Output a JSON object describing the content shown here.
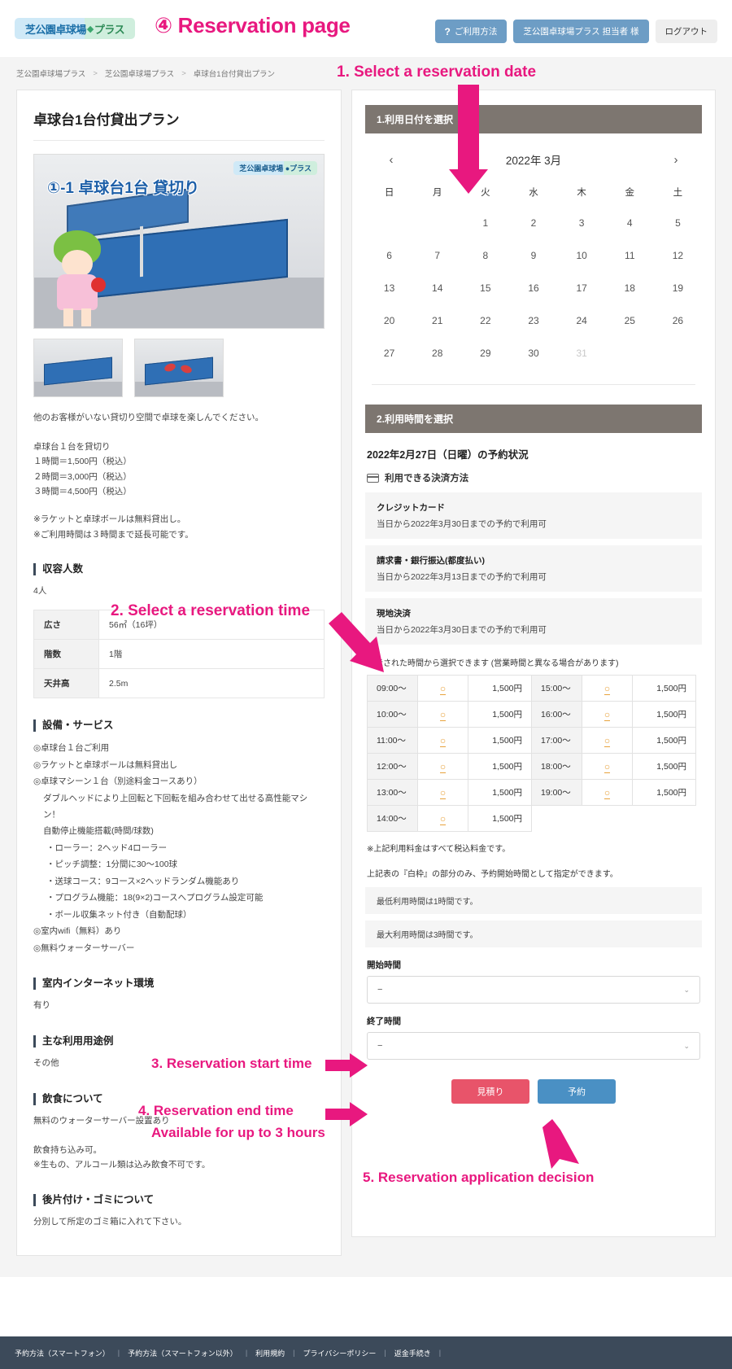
{
  "header": {
    "logo_text": "芝公園卓球場",
    "logo_text2": "プラス",
    "page_label": "④ Reservation page",
    "buttons": {
      "help_mark": "?",
      "help": "ご利用方法",
      "account": "芝公園卓球場プラス 担当者 様",
      "logout": "ログアウト"
    }
  },
  "breadcrumb": {
    "items": [
      "芝公園卓球場プラス",
      "芝公園卓球場プラス",
      "卓球台1台付貸出プラン"
    ],
    "separator": ">"
  },
  "left": {
    "plan_title": "卓球台1台付貸出プラン",
    "photo_caption": "①-1 卓球台1台 貸切り",
    "photo_badge": "芝公園卓球場 ●プラス",
    "lead": "他のお客様がいない貸切り空間で卓球を楽しんでください。",
    "price_lines": [
      "卓球台１台を貸切り",
      "１時間＝1,500円（税込）",
      "２時間＝3,000円（税込）",
      "３時間＝4,500円（税込）"
    ],
    "notes": [
      "※ラケットと卓球ボールは無料貸出し。",
      "※ご利用時間は３時間まで延長可能です。"
    ],
    "capacity_head": "収容人数",
    "capacity_value": "4人",
    "spec_rows": [
      {
        "label": "広さ",
        "value": "56㎡（16坪）"
      },
      {
        "label": "階数",
        "value": "1階"
      },
      {
        "label": "天井高",
        "value": "2.5m"
      }
    ],
    "facility_head": "設備・サービス",
    "facility_items": [
      {
        "text": "◎卓球台１台ご利用",
        "indent": 0
      },
      {
        "text": "◎ラケットと卓球ボールは無料貸出し",
        "indent": 0
      },
      {
        "text": "◎卓球マシーン１台（別途料金コースあり）",
        "indent": 0
      },
      {
        "text": "ダブルヘッドにより上回転と下回転を組み合わせて出せる高性能マシン！",
        "indent": 1
      },
      {
        "text": "自動停止機能搭載(時間/球数)",
        "indent": 1
      },
      {
        "text": "・ローラー：2ヘッド4ローラー",
        "indent": 2
      },
      {
        "text": "・ピッチ調整：1分間に30〜100球",
        "indent": 2
      },
      {
        "text": "・送球コース：9コース×2ヘッドランダム機能あり",
        "indent": 2
      },
      {
        "text": "・プログラム機能：18(9×2)コースへプログラム設定可能",
        "indent": 2
      },
      {
        "text": "・ボール収集ネット付き（自動配球）",
        "indent": 2
      },
      {
        "text": "◎室内wifi（無料）あり",
        "indent": 0
      },
      {
        "text": "◎無料ウォーターサーバー",
        "indent": 0
      }
    ],
    "internet_head": "室内インターネット環境",
    "internet_value": "有り",
    "usage_head": "主な利用用途例",
    "usage_value": "その他",
    "food_head": "飲食について",
    "food_lines": [
      "無料のウォーターサーバー設置あり",
      "飲食持ち込み可。",
      "※生もの、アルコール類は込み飲食不可です。"
    ],
    "cleanup_head": "後片付け・ゴミについて",
    "cleanup_value": "分別して所定のゴミ箱に入れて下さい。"
  },
  "right": {
    "step1_title": "1.利用日付を選択",
    "calendar": {
      "prev": "‹",
      "next": "›",
      "month_label": "2022年 3月",
      "weekdays": [
        "日",
        "月",
        "火",
        "水",
        "木",
        "金",
        "土"
      ],
      "weeks": [
        [
          "",
          "",
          "1",
          "2",
          "3",
          "4",
          "5"
        ],
        [
          "6",
          "7",
          "8",
          "9",
          "10",
          "11",
          "12"
        ],
        [
          "13",
          "14",
          "15",
          "16",
          "17",
          "18",
          "19"
        ],
        [
          "20",
          "21",
          "22",
          "23",
          "24",
          "25",
          "26"
        ],
        [
          "27",
          "28",
          "29",
          "30",
          "31",
          "",
          ""
        ]
      ],
      "disabled_days": [
        "31"
      ]
    },
    "step2_title": "2.利用時間を選択",
    "reserve_date_status": "2022年2月27日（日曜）の予約状況",
    "payment_head": "利用できる決済方法",
    "payments": [
      {
        "name": "クレジットカード",
        "desc": "当日から2022年3月30日までの予約で利用可"
      },
      {
        "name": "請求書・銀行振込(都度払い)",
        "desc": "当日から2022年3月13日までの予約で利用可"
      },
      {
        "name": "現地決済",
        "desc": "当日から2022年3月30日までの予約で利用可"
      }
    ],
    "slot_note": "表示された時間から選択できます (営業時間と異なる場合があります)",
    "slot_mark": "○",
    "slots_left": [
      {
        "time": "09:00〜",
        "mark": "○",
        "price": "1,500円"
      },
      {
        "time": "10:00〜",
        "mark": "○",
        "price": "1,500円"
      },
      {
        "time": "11:00〜",
        "mark": "○",
        "price": "1,500円"
      },
      {
        "time": "12:00〜",
        "mark": "○",
        "price": "1,500円"
      },
      {
        "time": "13:00〜",
        "mark": "○",
        "price": "1,500円"
      },
      {
        "time": "14:00〜",
        "mark": "○",
        "price": "1,500円"
      }
    ],
    "slots_right": [
      {
        "time": "15:00〜",
        "mark": "○",
        "price": "1,500円"
      },
      {
        "time": "16:00〜",
        "mark": "○",
        "price": "1,500円"
      },
      {
        "time": "17:00〜",
        "mark": "○",
        "price": "1,500円"
      },
      {
        "time": "18:00〜",
        "mark": "○",
        "price": "1,500円"
      },
      {
        "time": "19:00〜",
        "mark": "○",
        "price": "1,500円"
      }
    ],
    "tax_note": "※上記利用料金はすべて税込料金です。",
    "white_note": "上記表の『白枠』の部分のみ、予約開始時間として指定ができます。",
    "min_hours": "最低利用時間は1時間です。",
    "max_hours": "最大利用時間は3時間です。",
    "start_label": "開始時間",
    "start_value": "−",
    "end_label": "終了時間",
    "end_value": "−",
    "quote_button": "見積り",
    "book_button": "予約",
    "chevron": "⌄"
  },
  "annotations": {
    "a1": "1. Select a reservation date",
    "a2": "2. Select a reservation time",
    "a3": "3. Reservation start time",
    "a4": "4. Reservation end time",
    "a4b": "Available for up to 3 hours",
    "a5": "5. Reservation application decision"
  },
  "footer": {
    "links": [
      "予約方法（スマートフォン）",
      "予約方法（スマートフォン以外）",
      "利用規約",
      "プライバシーポリシー",
      "返金手続き"
    ],
    "separator": "|"
  }
}
